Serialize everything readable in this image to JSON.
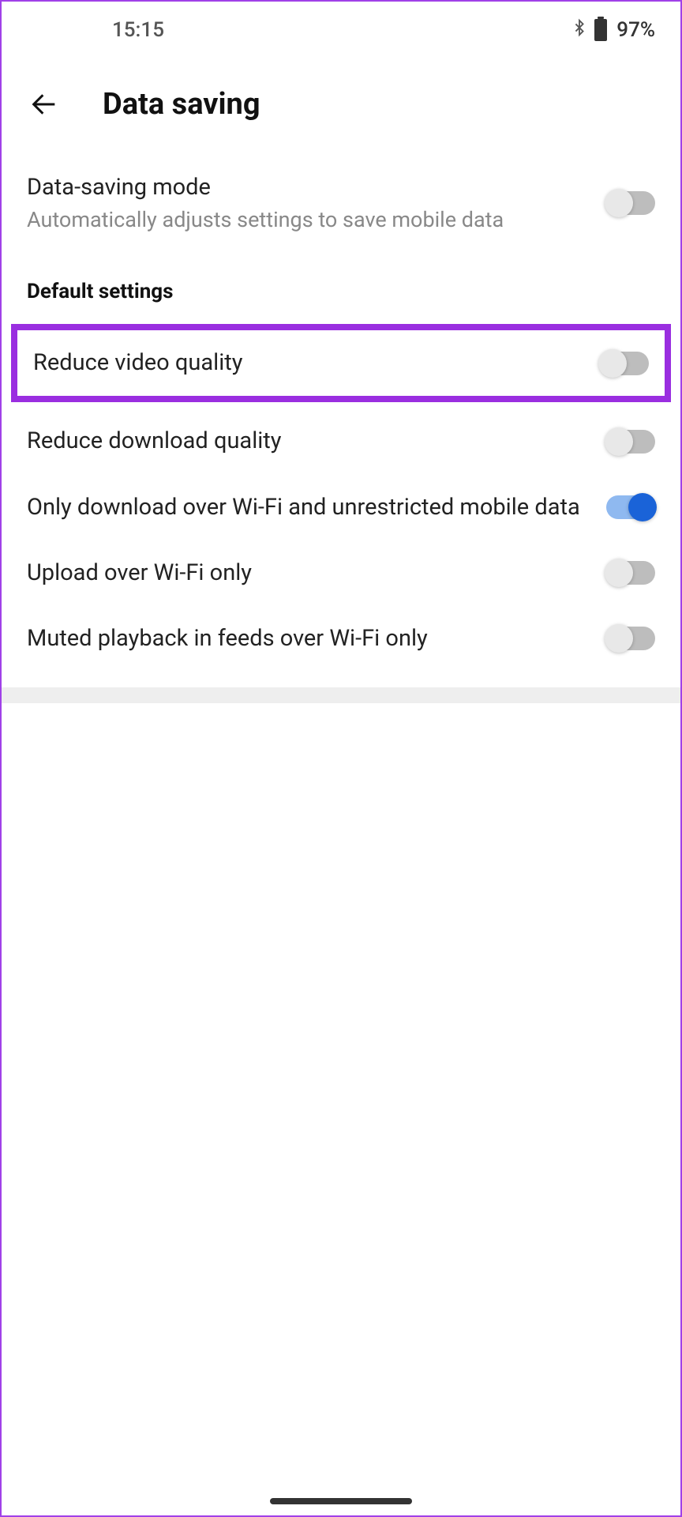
{
  "status": {
    "time": "15:15",
    "battery_percent": "97%"
  },
  "header": {
    "title": "Data saving"
  },
  "settings": {
    "data_saving_mode": {
      "title": "Data-saving mode",
      "subtitle": "Automatically adjusts settings to save mobile data",
      "on": false
    },
    "section_header": "Default settings",
    "reduce_video_quality": {
      "title": "Reduce video quality",
      "on": false
    },
    "reduce_download_quality": {
      "title": "Reduce download quality",
      "on": false
    },
    "wifi_download_only": {
      "title": "Only download over Wi-Fi and unrestricted mobile data",
      "on": true
    },
    "upload_wifi_only": {
      "title": "Upload over Wi-Fi only",
      "on": false
    },
    "muted_playback_wifi": {
      "title": "Muted playback in feeds over Wi-Fi only",
      "on": false
    }
  }
}
